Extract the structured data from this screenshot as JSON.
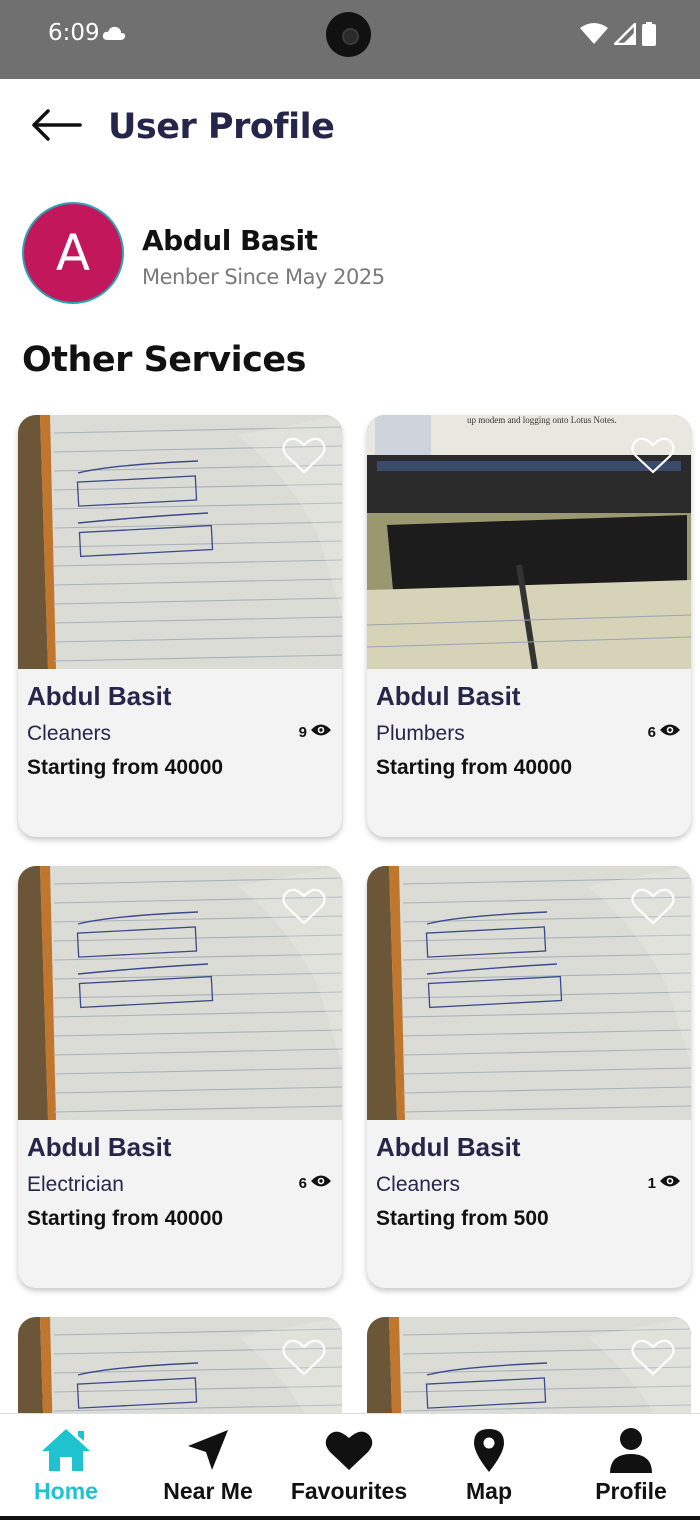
{
  "status_bar": {
    "time": "6:09"
  },
  "header": {
    "title": "User Profile"
  },
  "profile": {
    "initial": "A",
    "name": "Abdul Basit",
    "member_since": "Menber Since May 2025"
  },
  "section": {
    "title": "Other Services"
  },
  "services": [
    {
      "name": "Abdul Basit",
      "category": "Cleaners",
      "price": "Starting from 40000",
      "views": "9",
      "image": "notebook-math"
    },
    {
      "name": "Abdul Basit",
      "category": "Plumbers",
      "price": "Starting from 40000",
      "views": "6",
      "image": "laptop-notebook",
      "image_caption": "up modem and logging onto Lotus Notes."
    },
    {
      "name": "Abdul Basit",
      "category": "Electrician",
      "price": "Starting from 40000",
      "views": "6",
      "image": "notebook-math"
    },
    {
      "name": "Abdul Basit",
      "category": "Cleaners",
      "price": "Starting from 500",
      "views": "1",
      "image": "notebook-math"
    }
  ],
  "bottom_nav": {
    "items": [
      {
        "label": "Home",
        "icon": "home-icon",
        "active": true
      },
      {
        "label": "Near Me",
        "icon": "navigation-arrow-icon",
        "active": false
      },
      {
        "label": "Favourites",
        "icon": "heart-icon",
        "active": false
      },
      {
        "label": "Map",
        "icon": "map-pin-icon",
        "active": false
      },
      {
        "label": "Profile",
        "icon": "person-icon",
        "active": false
      }
    ]
  },
  "colors": {
    "accent": "#1fc3cf",
    "title": "#26264a",
    "avatar_bg": "#c2185b",
    "status_bar": "#707070",
    "card_bg": "#f3f3f3"
  }
}
